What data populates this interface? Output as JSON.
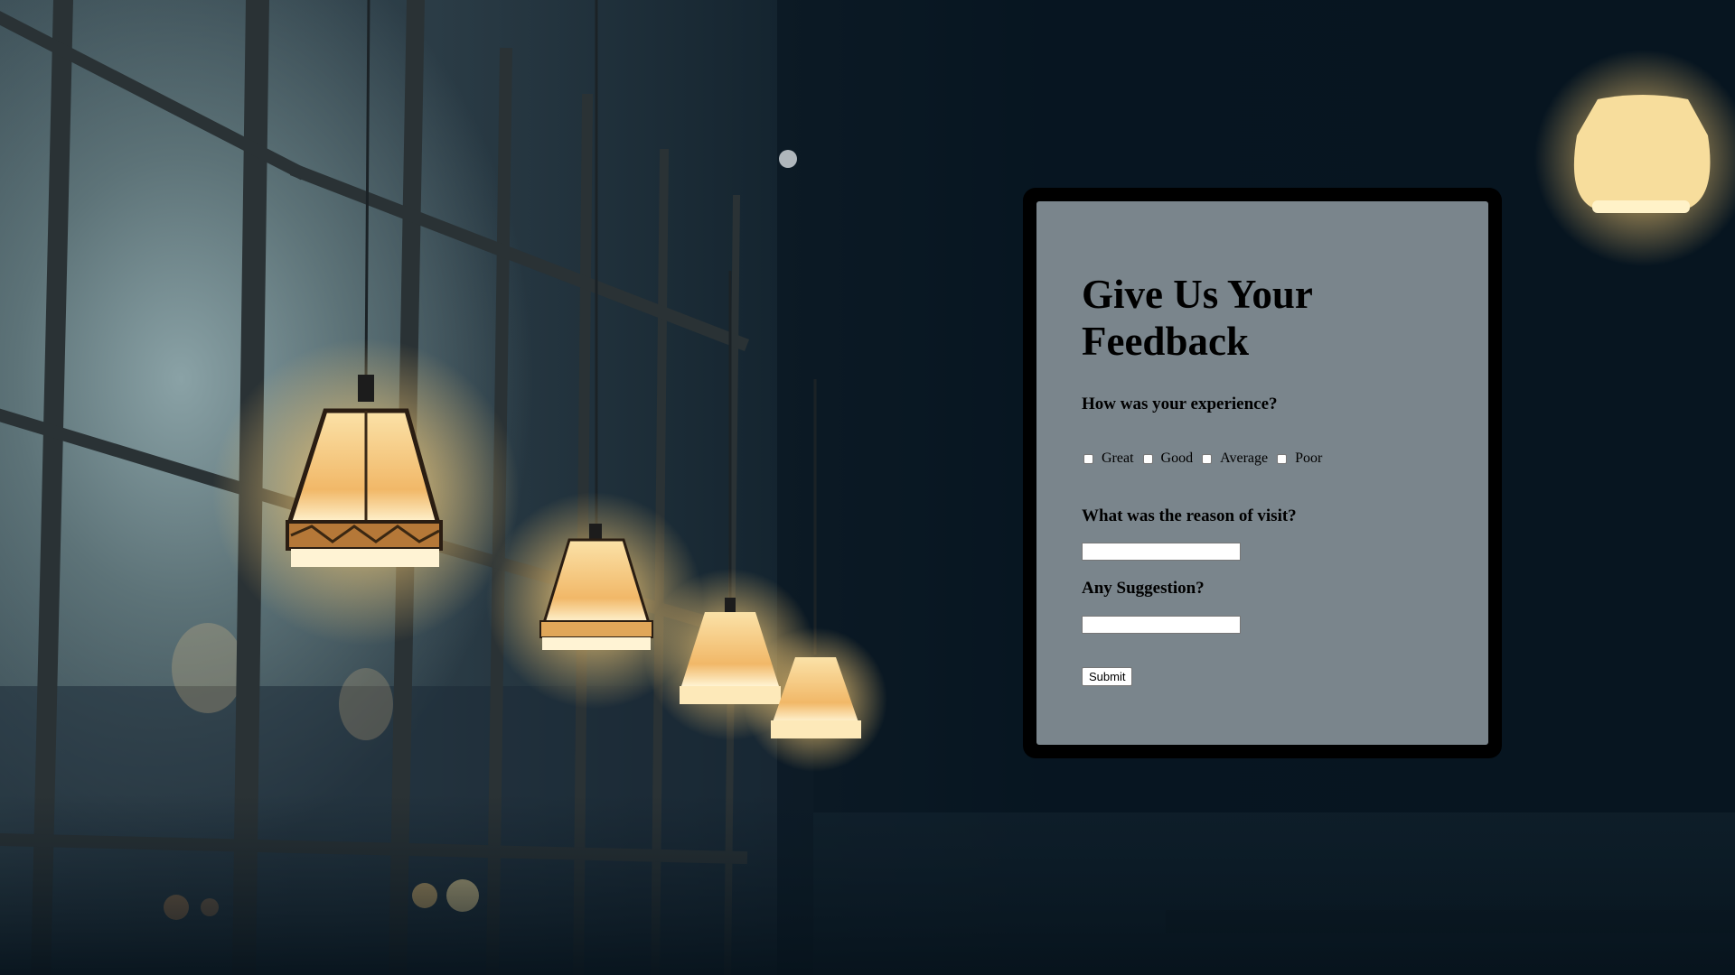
{
  "form": {
    "title": "Give Us Your Feedback",
    "question_experience": "How was your experience?",
    "options": [
      "Great",
      "Good",
      "Average",
      "Poor"
    ],
    "question_reason": "What was the reason of visit?",
    "reason_value": "",
    "question_suggestion": "Any Suggestion?",
    "suggestion_value": "",
    "submit_label": "Submit"
  },
  "colors": {
    "card_background": "#7a858c",
    "card_border": "#000000",
    "lamp_glow": "#f5d79a"
  }
}
